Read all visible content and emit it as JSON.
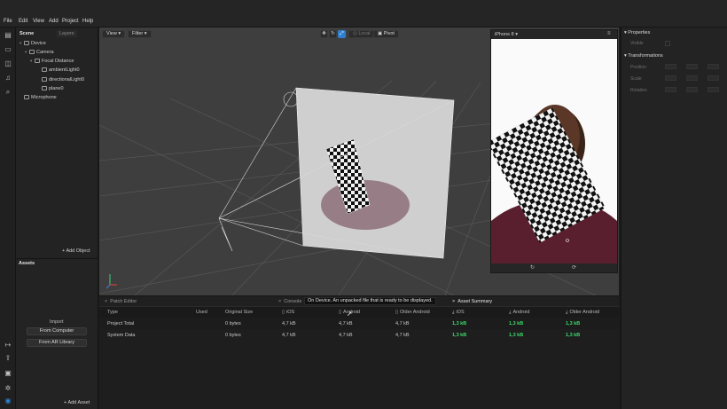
{
  "menu": [
    "File",
    "Edit",
    "View",
    "Add",
    "Project",
    "Help"
  ],
  "scene_panel": {
    "tabs": [
      "Scene",
      "Layers"
    ],
    "tree": [
      {
        "label": "Device",
        "indent": 0,
        "icon": "device-icon"
      },
      {
        "label": "Camera",
        "indent": 1,
        "icon": "camera-icon"
      },
      {
        "label": "Focal Distance",
        "indent": 2,
        "icon": "focal-distance-icon"
      },
      {
        "label": "ambientLight0",
        "indent": 3,
        "icon": "light-icon"
      },
      {
        "label": "directionalLight0",
        "indent": 3,
        "icon": "light-icon"
      },
      {
        "label": "plane0",
        "indent": 3,
        "icon": "plane-icon"
      },
      {
        "label": "Microphone",
        "indent": 0,
        "icon": "microphone-icon"
      }
    ],
    "add_object": "Add Object"
  },
  "assets_panel": {
    "title": "Assets",
    "import_label": "Import",
    "from_computer": "From Computer",
    "from_ar_library": "From AR Library",
    "add_asset": "Add Asset"
  },
  "viewport": {
    "view_label": "View",
    "filter_label": "Filter",
    "local_label": "Local",
    "pivot_label": "Pivot"
  },
  "simulator": {
    "device": "iPhone 8"
  },
  "properties": {
    "title": "Properties",
    "visible_label": "Visible",
    "transformations_title": "Transformations",
    "rows": [
      "Position",
      "Scale",
      "Rotation"
    ]
  },
  "bottom": {
    "tabs": [
      "Patch Editor",
      "Console",
      "Asset Summary"
    ],
    "notification": "On Device. An unpacked file that is ready to be displayed.",
    "columns": [
      "Type",
      "Used",
      "Original Size",
      "iOS",
      "Android",
      "Older Android",
      "iOS",
      "Android",
      "Older Android"
    ],
    "rows": [
      {
        "type": "Project Total",
        "used": "",
        "original": "0 bytes",
        "ios": "4,7 kB",
        "android": "4,7 kB",
        "older": "4,7 kB",
        "c_ios": "1,3 kB",
        "c_android": "1,3 kB",
        "c_older": "1,3 kB"
      },
      {
        "type": "System Data",
        "used": "",
        "original": "0 bytes",
        "ios": "4,7 kB",
        "android": "4,7 kB",
        "older": "4,7 kB",
        "c_ios": "1,3 kB",
        "c_android": "1,3 kB",
        "c_older": "1,3 kB"
      }
    ]
  },
  "colors": {
    "accent": "#2f7fd0",
    "green": "#3ddc6a",
    "background": "#1b1b1b"
  }
}
